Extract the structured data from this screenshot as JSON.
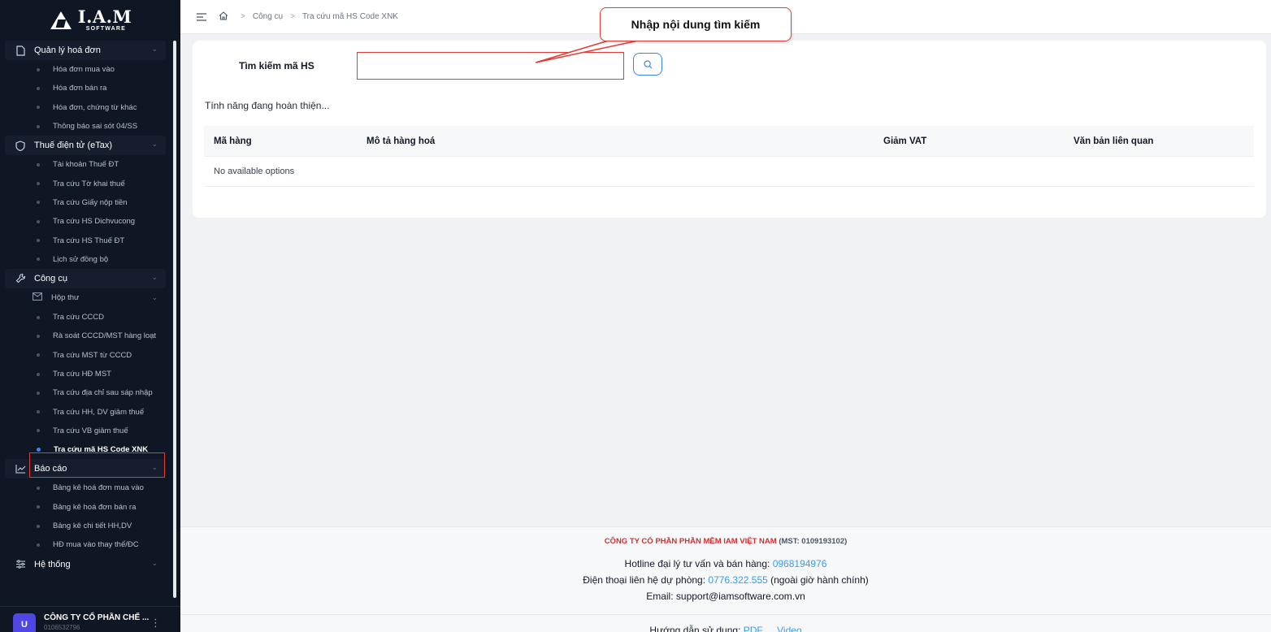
{
  "brand": {
    "name": "I.A.M",
    "sub": "SOFTWARE"
  },
  "sidebar": {
    "groups": [
      {
        "label": "Quản lý hoá đơn",
        "icon": "file-icon",
        "items": [
          "Hóa đơn mua vào",
          "Hóa đơn bán ra",
          "Hóa đơn, chứng từ khác",
          "Thông báo sai sót 04/SS"
        ]
      },
      {
        "label": "Thuế điện tử (eTax)",
        "icon": "shield-icon",
        "items": [
          "Tài khoản Thuế ĐT",
          "Tra cứu Tờ khai thuế",
          "Tra cứu Giấy nộp tiền",
          "Tra cứu HS Dichvucong",
          "Tra cứu HS Thuế ĐT",
          "Lịch sử đồng bộ"
        ]
      },
      {
        "label": "Công cụ",
        "icon": "wrench-icon",
        "subgroup": "Hộp thư",
        "items": [
          "Tra cứu CCCD",
          "Rà soát CCCD/MST hàng loạt",
          "Tra cứu MST từ CCCD",
          "Tra cứu HĐ MST",
          "Tra cứu địa chỉ sau sáp nhập",
          "Tra cứu HH, DV giảm thuế",
          "Tra cứu VB giảm thuế",
          "Tra cứu mã HS Code XNK"
        ]
      },
      {
        "label": "Báo cáo",
        "icon": "chart-icon",
        "items": [
          "Bảng kê hoá đơn mua vào",
          "Bảng kê hoá đơn bán ra",
          "Bảng kê chi tiết HH,DV",
          "HĐ mua vào thay thế/ĐC"
        ]
      },
      {
        "label": "Hệ thống",
        "icon": "sliders-icon",
        "items": []
      }
    ],
    "user": {
      "initial": "U",
      "name": "CÔNG TY CỔ PHẦN CHẾ ...",
      "tax": "0106532796"
    }
  },
  "breadcrumb": [
    "Công cụ",
    "Tra cứu mã HS Code XNK"
  ],
  "search": {
    "label": "Tìm kiếm mã HS",
    "value": "",
    "placeholder": ""
  },
  "notice": "Tính năng đang hoàn thiện...",
  "table": {
    "headers": [
      "Mã hàng",
      "Mô tả hàng hoá",
      "Giảm VAT",
      "Văn bản liên quan"
    ],
    "empty": "No available options"
  },
  "callout": "Nhập nội dung tìm kiếm",
  "footer": {
    "company": "CÔNG TY CỔ PHẦN PHẦN MỀM IAM VIỆT NAM",
    "mst": "(MST: 0109193102)",
    "hotline_label": "Hotline đại lý tư vấn và bán hàng:",
    "hotline": "0968194976",
    "backup_label": "Điện thoại liên hệ dự phòng:",
    "backup": "0776.322.555",
    "backup_note": "(ngoài giờ hành chính)",
    "email_label": "Email:",
    "email": "support@iamsoftware.com.vn",
    "guide_label": "Hướng dẫn sử dụng:",
    "guide_pdf": "PDF",
    "guide_video": "Video"
  }
}
